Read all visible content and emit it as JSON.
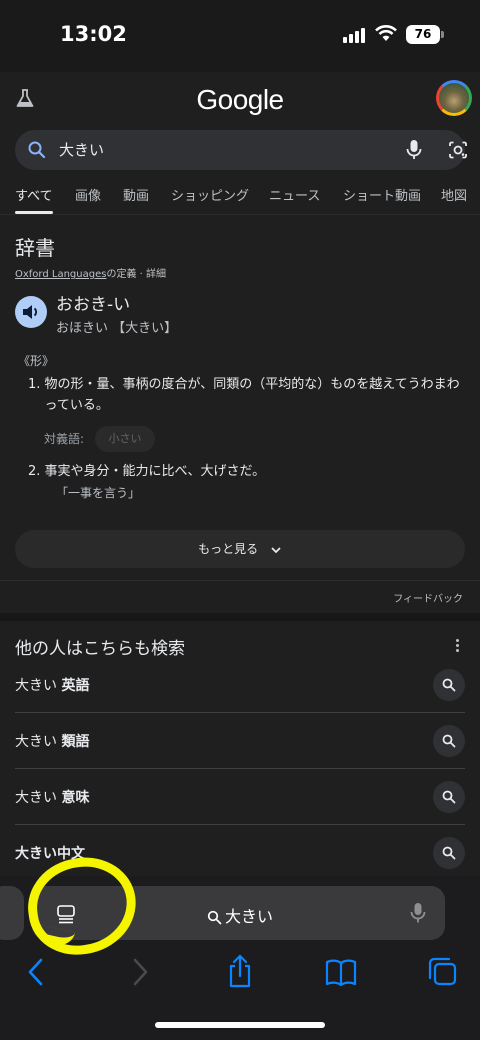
{
  "status": {
    "time": "13:02",
    "battery": "76"
  },
  "header": {
    "logo": "Google",
    "labs_icon": "flask-icon",
    "avatar_icon": "account-avatar"
  },
  "search": {
    "query": "大きい"
  },
  "tabs": [
    "すべて",
    "画像",
    "動画",
    "ショッピング",
    "ニュース",
    "ショート動画",
    "地図"
  ],
  "dictionary": {
    "title": "辞書",
    "source_link": "Oxford Languages",
    "source_rest": "の定義 · 詳細",
    "word": "おおき-い",
    "reading": "おほきい 【大きい】",
    "pos": "《形》",
    "def1_num": "1.",
    "def1": "物の形・量、事柄の度合が、同類の（平均的な）ものを越えてうわまわっている。",
    "antonym_label": "対義語:",
    "antonym": "小さい",
    "def2_num": "2.",
    "def2": "事実や身分・能力に比べ、大げさだ。",
    "example": "「一事を言う」",
    "more": "もっと見る",
    "feedback": "フィードバック"
  },
  "related": {
    "title": "他の人はこちらも検索",
    "items": [
      {
        "base": "大きい ",
        "bold": "英語"
      },
      {
        "base": "大きい ",
        "bold": "類語"
      },
      {
        "base": "大きい ",
        "bold": "意味"
      },
      {
        "base": "",
        "bold": "大きい中文"
      }
    ]
  },
  "browser": {
    "address": "大きい",
    "accent": "#0a84ff",
    "annotation_color": "#f5f500"
  }
}
